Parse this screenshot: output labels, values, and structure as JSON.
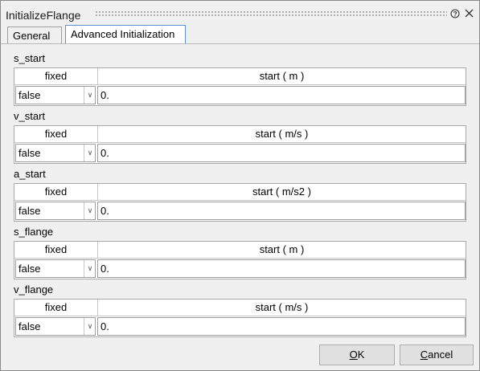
{
  "window": {
    "title": "InitializeFlange",
    "help_icon": "question-circle-icon",
    "close_icon": "close-icon"
  },
  "tabs": [
    {
      "label": "General",
      "active": false
    },
    {
      "label": "Advanced Initialization",
      "active": true
    }
  ],
  "columns": {
    "fixed": "fixed"
  },
  "params": [
    {
      "name": "s_start",
      "start_header": "start ( m )",
      "fixed_value": "false",
      "start_value": "0."
    },
    {
      "name": "v_start",
      "start_header": "start ( m/s )",
      "fixed_value": "false",
      "start_value": "0."
    },
    {
      "name": "a_start",
      "start_header": "start ( m/s2 )",
      "fixed_value": "false",
      "start_value": "0."
    },
    {
      "name": "s_flange",
      "start_header": "start ( m )",
      "fixed_value": "false",
      "start_value": "0."
    },
    {
      "name": "v_flange",
      "start_header": "start ( m/s )",
      "fixed_value": "false",
      "start_value": "0."
    }
  ],
  "buttons": {
    "ok": {
      "mnemonic": "O",
      "rest": "K"
    },
    "cancel": {
      "mnemonic": "C",
      "rest": "ancel"
    }
  },
  "colors": {
    "active_tab_border": "#5b8fd6",
    "dialog_bg": "#f0f0f0"
  }
}
